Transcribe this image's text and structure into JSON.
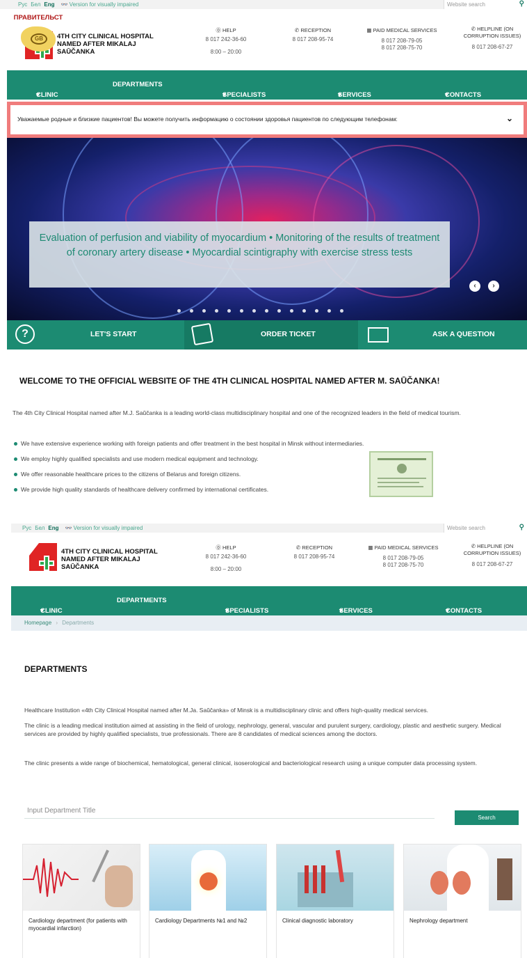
{
  "topbar": {
    "langs": [
      "Рус",
      "Бел",
      "Eng"
    ],
    "visually_impaired": "Version for visually impaired",
    "search_placeholder": "Website search"
  },
  "header": {
    "hospital_name": "4TH CITY CLINICAL HOSPITAL NAMED AFTER MIKALAJ SAŪČANKA",
    "help": {
      "title": "HELP",
      "phone": "8 017 242-36-60",
      "hours": "8:00 – 20:00"
    },
    "reception": {
      "title": "RECEPTION",
      "phone": "8 017 208-95-74"
    },
    "paid": {
      "title": "PAID MEDICAL SERVICES",
      "phone1": "8 017 208-79-05",
      "phone2": "8 017 208-75-70"
    },
    "helpline": {
      "title": "HELPLINE (ON CORRUPTION ISSUES)",
      "phone": "8 017 208-67-27"
    }
  },
  "nav": {
    "clinic": "CLINIC",
    "departments": "DEPARTMENTS",
    "specialists": "SPECIALISTS",
    "services": "SERVICES",
    "contacts": "CONTACTS"
  },
  "alert": {
    "text": "Уважаемые родные и близкие пациентов! Вы можете получить информацию о состоянии здоровья пациентов по следующим телефонам:"
  },
  "hero": {
    "caption": "Evaluation of perfusion and viability of myocardium • Monitoring of the results of treatment of coronary artery disease • Myocardial scintigraphy with exercise stress tests"
  },
  "actions": {
    "start": "LET'S START",
    "ticket": "ORDER TICKET",
    "question": "ASK A QUESTION"
  },
  "home": {
    "welcome": "WELCOME TO THE OFFICIAL WEBSITE OF THE 4TH CLINICAL HOSPITAL NAMED AFTER M. SAŪČANKA!",
    "intro": "The 4th City Clinical Hospital named after M.J. Saŭčanka is a leading world-class multidisciplinary hospital and one of the recognized leaders in the field of medical tourism.",
    "bullets": [
      "We have extensive experience working with foreign patients and offer treatment in the best hospital in Minsk without intermediaries.",
      "We employ highly qualified specialists and use modern medical equipment and technology.",
      "We offer reasonable healthcare prices to the citizens of Belarus and foreign citizens.",
      "We provide high quality standards of healthcare delivery confirmed by international certificates."
    ],
    "seal_text": "ПРАВИТЕЛЬСТ",
    "seal_mark": "GB"
  },
  "departments_page": {
    "breadcrumb": {
      "home": "Homepage",
      "current": "Departments"
    },
    "title": "DEPARTMENTS",
    "para1": "Healthcare Institution «4th City Clinical Hospital named after M.Ja. Saŭčanka» of Minsk is a multidisciplinary clinic and offers high-quality medical services.",
    "para2": "The clinic is a leading medical institution aimed at assisting in the field of urology, nephrology, general, vascular and purulent surgery, cardiology, plastic and aesthetic surgery. Medical services are provided by highly qualified specialists, true professionals. There are 8 candidates of medical sciences among the doctors.",
    "para3": "The clinic presents a wide range of biochemical, hematological, general clinical, isoserological and bacteriological research using a unique computer data processing system.",
    "search_placeholder": "Input Department Title",
    "search_button": "Search",
    "cards": [
      "Cardiology department (for patients with myocardial infarction)",
      "Cardiology Departments №1 and №2",
      "Clinical diagnostic laboratory",
      "Nephrology department"
    ]
  },
  "colors": {
    "brand_green": "#1c8b72",
    "alert_red": "#f07c7c",
    "logo_red": "#e02424"
  }
}
